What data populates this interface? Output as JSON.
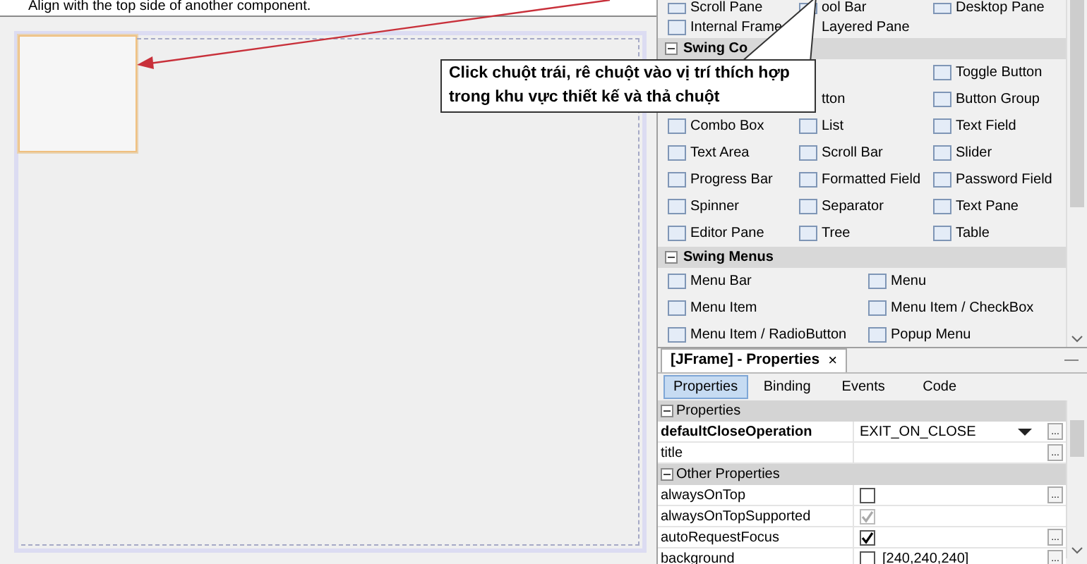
{
  "hint": {
    "text": "Align with the top side of another component."
  },
  "callout": {
    "text": "Click chuột trái, rê chuột vào vị trí thích hợp trong khu vực thiết kế và thả chuột"
  },
  "palette": {
    "sections": [
      {
        "rows": [
          [
            {
              "label": "Scroll Pane",
              "icon_visible": true
            },
            {
              "label": "ool Bar",
              "icon_visible": true
            },
            {
              "label": "Desktop Pane",
              "icon_visible": true
            }
          ],
          [
            {
              "label": "Internal Frame",
              "icon_visible": true
            },
            {
              "label": "Layered Pane",
              "icon_visible": false
            },
            null
          ]
        ]
      },
      {
        "title": "Swing Co",
        "expanded": true,
        "rows": [
          [
            null,
            null,
            {
              "label": "Toggle Button",
              "icon_visible": true
            }
          ],
          [
            null,
            {
              "label": "tton",
              "icon_visible": false
            },
            {
              "label": "Button Group",
              "icon_visible": true
            }
          ],
          [
            {
              "label": "Combo Box",
              "icon_visible": true
            },
            {
              "label": "List",
              "icon_visible": true
            },
            {
              "label": "Text Field",
              "icon_visible": true
            }
          ],
          [
            {
              "label": "Text Area",
              "icon_visible": true
            },
            {
              "label": "Scroll Bar",
              "icon_visible": true
            },
            {
              "label": "Slider",
              "icon_visible": true
            }
          ],
          [
            {
              "label": "Progress Bar",
              "icon_visible": true
            },
            {
              "label": "Formatted Field",
              "icon_visible": true
            },
            {
              "label": "Password Field",
              "icon_visible": true
            }
          ],
          [
            {
              "label": "Spinner",
              "icon_visible": true
            },
            {
              "label": "Separator",
              "icon_visible": true
            },
            {
              "label": "Text Pane",
              "icon_visible": true
            }
          ],
          [
            {
              "label": "Editor Pane",
              "icon_visible": true
            },
            {
              "label": "Tree",
              "icon_visible": true
            },
            {
              "label": "Table",
              "icon_visible": true
            }
          ]
        ]
      },
      {
        "title": "Swing Menus",
        "expanded": true,
        "rows": [
          [
            {
              "label": "Menu Bar",
              "icon_visible": true
            },
            {
              "label": "Menu",
              "icon_visible": true
            }
          ],
          [
            {
              "label": "Menu Item",
              "icon_visible": true
            },
            {
              "label": "Menu Item / CheckBox",
              "icon_visible": true
            }
          ],
          [
            {
              "label": "Menu Item / RadioButton",
              "icon_visible": true
            },
            {
              "label": "Popup Menu",
              "icon_visible": true
            }
          ]
        ]
      }
    ]
  },
  "properties_window": {
    "title": "[JFrame] - Properties",
    "close": "×",
    "minimize": "—",
    "tabs": [
      {
        "label": "Properties",
        "selected": true
      },
      {
        "label": "Binding",
        "selected": false
      },
      {
        "label": "Events",
        "selected": false
      },
      {
        "label": "Code",
        "selected": false
      }
    ],
    "rows": [
      {
        "kind": "category",
        "label": "Properties",
        "expanded": true
      },
      {
        "kind": "combo",
        "name": "defaultCloseOperation",
        "bold": true,
        "value": "EXIT_ON_CLOSE",
        "button": "..."
      },
      {
        "kind": "text",
        "name": "title",
        "bold": false,
        "button": "..."
      },
      {
        "kind": "category",
        "label": "Other Properties",
        "expanded": true
      },
      {
        "kind": "checkbox",
        "name": "alwaysOnTop",
        "bold": false,
        "checked": false,
        "disabled": false,
        "button": "..."
      },
      {
        "kind": "checkbox",
        "name": "alwaysOnTopSupported",
        "bold": false,
        "checked": true,
        "disabled": true
      },
      {
        "kind": "checkbox",
        "name": "autoRequestFocus",
        "bold": false,
        "checked": true,
        "disabled": false,
        "button": "..."
      },
      {
        "kind": "checkbox",
        "name": "background",
        "bold": false,
        "checked": false,
        "disabled": false,
        "value": "[240,240,240]",
        "button": "..."
      }
    ]
  }
}
